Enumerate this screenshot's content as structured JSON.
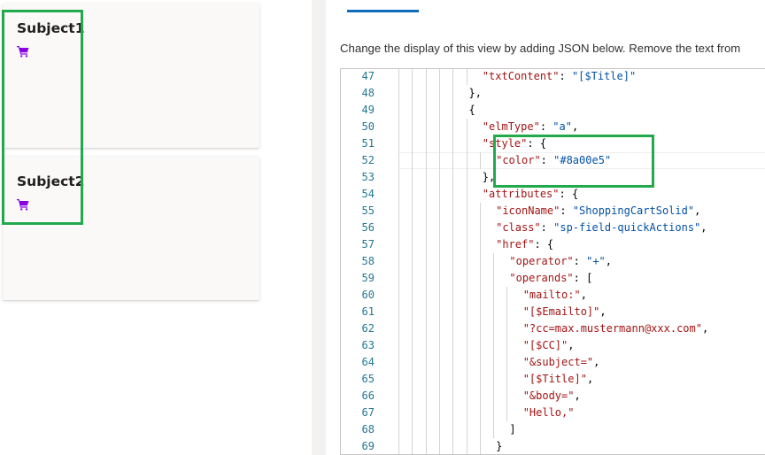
{
  "cards": [
    {
      "title": "Subject1",
      "icon": "shopping-cart-icon"
    },
    {
      "title": "Subject2",
      "icon": "shopping-cart-icon"
    }
  ],
  "colors": {
    "icon": "#8a00e5",
    "highlight": "#22a94c",
    "accent": "#0f6cbd"
  },
  "panel": {
    "instruction": "Change the display of this view by adding JSON below. Remove the text from"
  },
  "editor": {
    "lines": [
      {
        "n": "47",
        "indent": 6,
        "tokens": [
          [
            "k",
            "\"txtContent\""
          ],
          [
            "p",
            ": "
          ],
          [
            "s",
            "\"[$Title]\""
          ]
        ]
      },
      {
        "n": "48",
        "indent": 5,
        "tokens": [
          [
            "p",
            "},"
          ]
        ]
      },
      {
        "n": "49",
        "indent": 5,
        "tokens": [
          [
            "p",
            "{"
          ]
        ]
      },
      {
        "n": "50",
        "indent": 6,
        "tokens": [
          [
            "k",
            "\"elmType\""
          ],
          [
            "p",
            ": "
          ],
          [
            "s",
            "\"a\""
          ],
          [
            "p",
            ","
          ]
        ]
      },
      {
        "n": "51",
        "indent": 6,
        "tokens": [
          [
            "k",
            "\"style\""
          ],
          [
            "p",
            ": {"
          ]
        ]
      },
      {
        "n": "52",
        "indent": 7,
        "tokens": [
          [
            "k",
            "\"color\""
          ],
          [
            "p",
            ": "
          ],
          [
            "s",
            "\"#8a00e5\""
          ]
        ]
      },
      {
        "n": "53",
        "indent": 6,
        "tokens": [
          [
            "p",
            "},"
          ]
        ]
      },
      {
        "n": "54",
        "indent": 6,
        "tokens": [
          [
            "k",
            "\"attributes\""
          ],
          [
            "p",
            ": {"
          ]
        ]
      },
      {
        "n": "55",
        "indent": 7,
        "tokens": [
          [
            "k",
            "\"iconName\""
          ],
          [
            "p",
            ": "
          ],
          [
            "s",
            "\"ShoppingCartSolid\""
          ],
          [
            "p",
            ","
          ]
        ]
      },
      {
        "n": "56",
        "indent": 7,
        "tokens": [
          [
            "k",
            "\"class\""
          ],
          [
            "p",
            ": "
          ],
          [
            "s",
            "\"sp-field-quickActions\""
          ],
          [
            "p",
            ","
          ]
        ]
      },
      {
        "n": "57",
        "indent": 7,
        "tokens": [
          [
            "k",
            "\"href\""
          ],
          [
            "p",
            ": {"
          ]
        ]
      },
      {
        "n": "58",
        "indent": 8,
        "tokens": [
          [
            "k",
            "\"operator\""
          ],
          [
            "p",
            ": "
          ],
          [
            "s",
            "\"+\""
          ],
          [
            "p",
            ","
          ]
        ]
      },
      {
        "n": "59",
        "indent": 8,
        "tokens": [
          [
            "k",
            "\"operands\""
          ],
          [
            "p",
            ": ["
          ]
        ]
      },
      {
        "n": "60",
        "indent": 9,
        "tokens": [
          [
            "k",
            "\"mailto:\""
          ],
          [
            "p",
            ","
          ]
        ]
      },
      {
        "n": "61",
        "indent": 9,
        "tokens": [
          [
            "k",
            "\"[$Emailto]\""
          ],
          [
            "p",
            ","
          ]
        ]
      },
      {
        "n": "62",
        "indent": 9,
        "tokens": [
          [
            "k",
            "\"?cc=max.mustermann@xxx.com\""
          ],
          [
            "p",
            ","
          ]
        ]
      },
      {
        "n": "63",
        "indent": 9,
        "tokens": [
          [
            "k",
            "\"[$CC]\""
          ],
          [
            "p",
            ","
          ]
        ]
      },
      {
        "n": "64",
        "indent": 9,
        "tokens": [
          [
            "k",
            "\"&subject=\""
          ],
          [
            "p",
            ","
          ]
        ]
      },
      {
        "n": "65",
        "indent": 9,
        "tokens": [
          [
            "k",
            "\"[$Title]\""
          ],
          [
            "p",
            ","
          ]
        ]
      },
      {
        "n": "66",
        "indent": 9,
        "tokens": [
          [
            "k",
            "\"&body=\""
          ],
          [
            "p",
            ","
          ]
        ]
      },
      {
        "n": "67",
        "indent": 9,
        "tokens": [
          [
            "k",
            "\"Hello,\""
          ]
        ]
      },
      {
        "n": "68",
        "indent": 8,
        "tokens": [
          [
            "p",
            "]"
          ]
        ]
      },
      {
        "n": "69",
        "indent": 7,
        "tokens": [
          [
            "p",
            "}"
          ]
        ]
      }
    ]
  }
}
